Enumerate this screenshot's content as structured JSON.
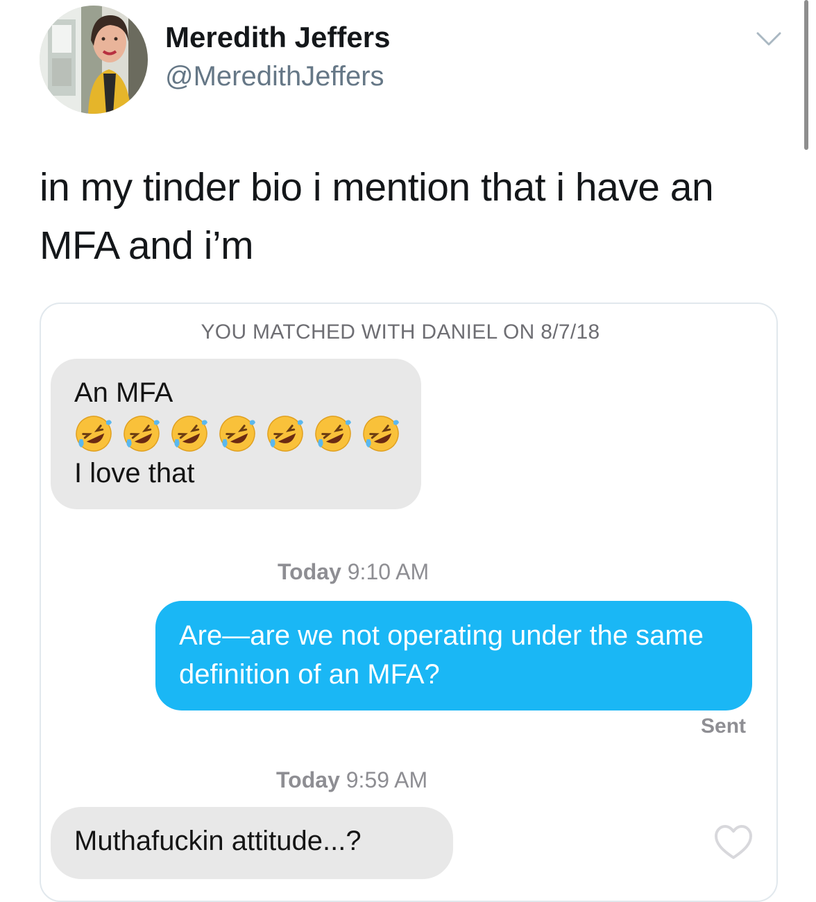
{
  "author": {
    "name": "Meredith Jeffers",
    "handle": "@MeredithJeffers",
    "avatar_icon": "profile-photo"
  },
  "tweet": {
    "text": "in my tinder bio i mention that i have an MFA and i’m"
  },
  "chat": {
    "match_label": "YOU MATCHED WITH DANIEL ON 8/7/18",
    "messages": [
      {
        "direction": "incoming",
        "line1": "An MFA",
        "emoji": "🤣🤣🤣🤣🤣🤣🤣",
        "emoji_icon": "rolling-on-floor-laughing",
        "emoji_count": 7,
        "line2": "I love that"
      },
      {
        "direction": "outgoing",
        "timestamp_day": "Today",
        "timestamp_time": "9:10 AM",
        "text": "Are—are we not operating under the same definition of an MFA?",
        "status": "Sent"
      },
      {
        "direction": "incoming",
        "timestamp_day": "Today",
        "timestamp_time": "9:59 AM",
        "text": "Muthafuckin attitude...?"
      }
    ]
  },
  "colors": {
    "outgoing_bubble": "#1ab7f5",
    "incoming_bubble": "#e8e8e8",
    "handle_gray": "#657786"
  },
  "icons": {
    "menu": "chevron-down-icon",
    "like": "heart-outline-icon"
  }
}
